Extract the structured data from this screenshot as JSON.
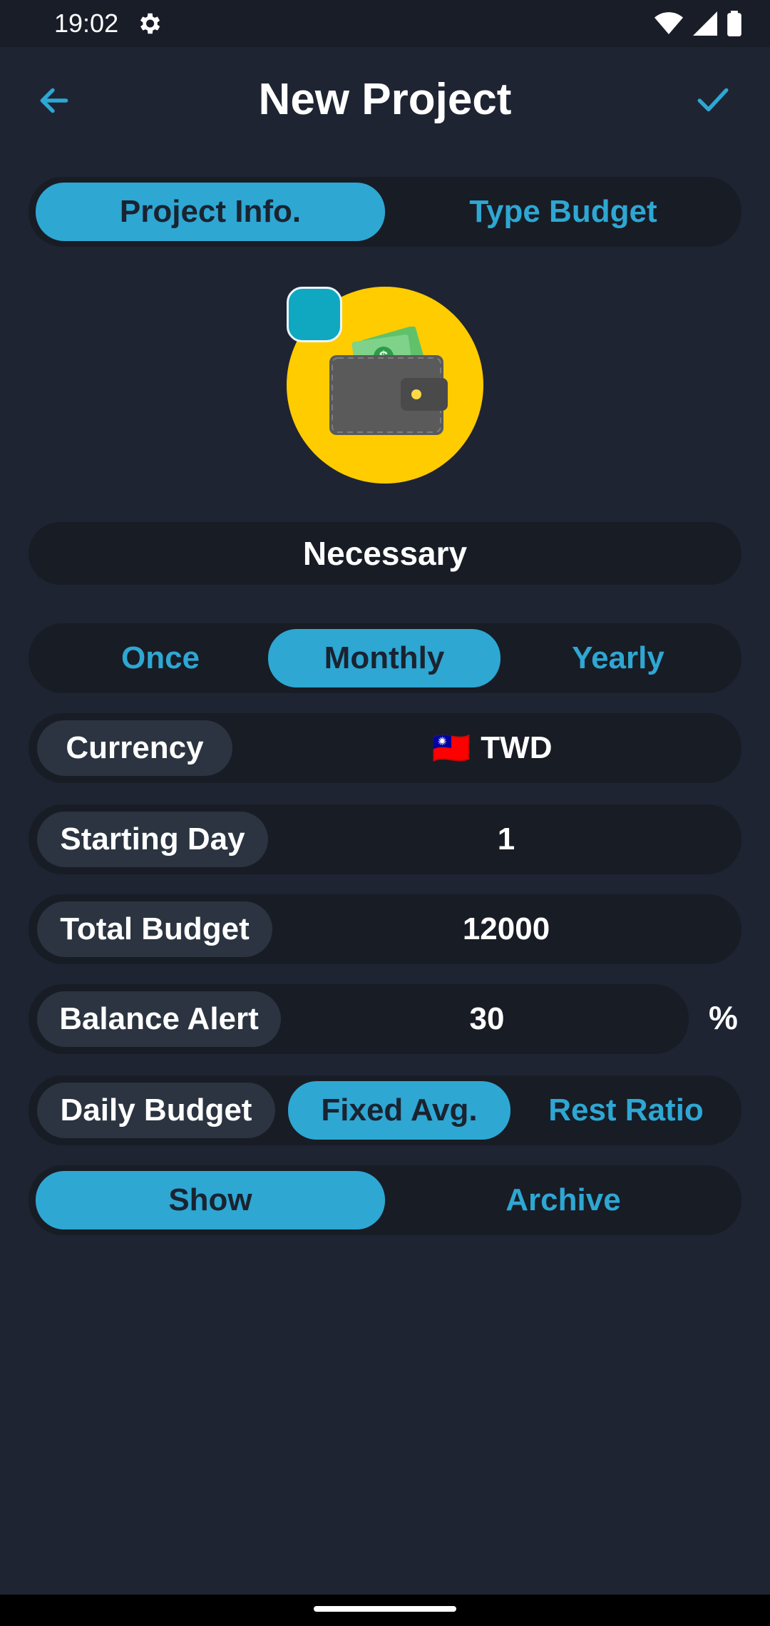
{
  "status_bar": {
    "time": "19:02",
    "icons": [
      "settings-gear-icon",
      "wifi-icon",
      "signal-icon",
      "battery-icon"
    ]
  },
  "app_bar": {
    "title": "New Project",
    "back_icon": "arrow-left-icon",
    "confirm_icon": "check-icon"
  },
  "top_tabs": {
    "items": [
      "Project Info.",
      "Type Budget"
    ],
    "selected": "Project Info."
  },
  "project_icon": {
    "icon": "wallet-icon",
    "background_color": "#ffcc00",
    "tag_color": "#0fa8c0"
  },
  "project_name": "Necessary",
  "period": {
    "options": [
      "Once",
      "Monthly",
      "Yearly"
    ],
    "selected": "Monthly"
  },
  "currency": {
    "label": "Currency",
    "flag": "🇹🇼",
    "value": "TWD"
  },
  "starting_day": {
    "label": "Starting Day",
    "value": "1"
  },
  "total_budget": {
    "label": "Total Budget",
    "value": "12000"
  },
  "balance_alert": {
    "label": "Balance Alert",
    "value": "30",
    "unit": "%"
  },
  "daily_budget": {
    "label": "Daily Budget",
    "options": [
      "Fixed Avg.",
      "Rest Ratio"
    ],
    "selected": "Fixed Avg."
  },
  "visibility": {
    "options": [
      "Show",
      "Archive"
    ],
    "selected": "Show"
  },
  "colors": {
    "accent": "#2ea7d3",
    "background": "#1f2433",
    "field": "#181c25",
    "chip": "#2b3440"
  }
}
